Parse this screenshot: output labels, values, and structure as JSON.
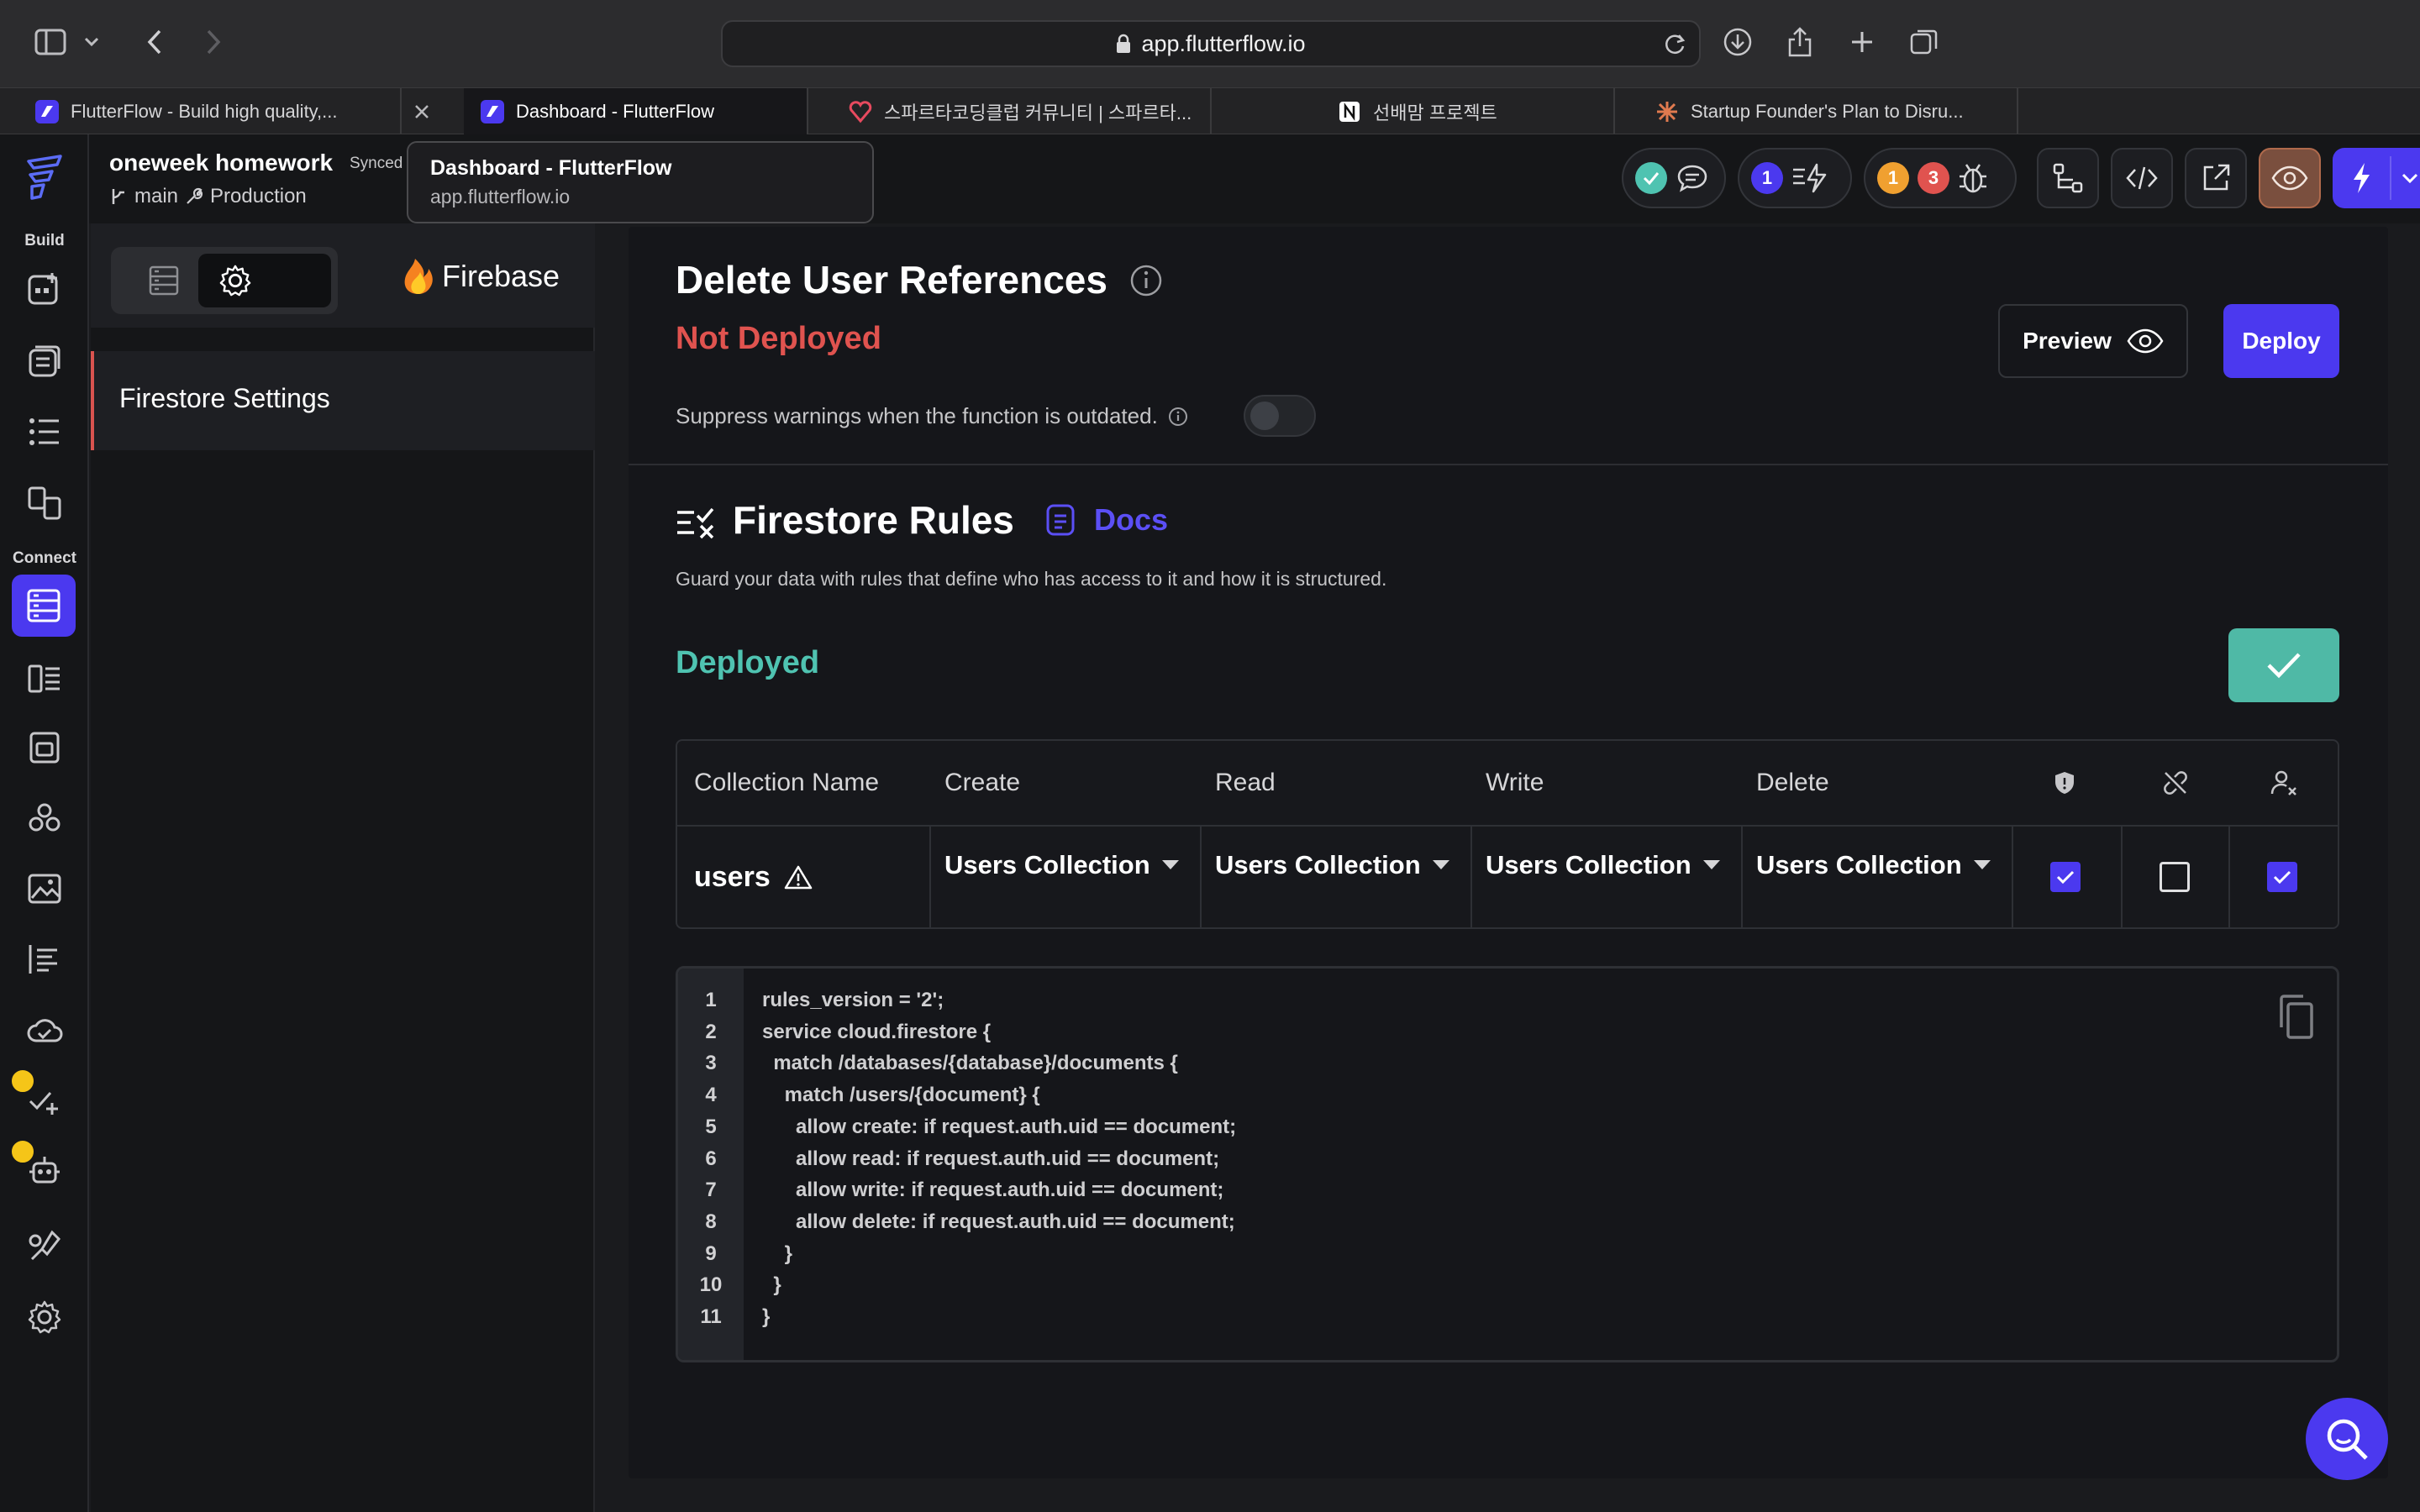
{
  "browser": {
    "url": "app.flutterflow.io",
    "tabs": [
      {
        "label": "FlutterFlow - Build high quality,..."
      },
      {
        "label": "Dashboard - FlutterFlow"
      },
      {
        "label": "스파르타코딩클럽 커뮤니티 | 스파르타..."
      },
      {
        "label": "선배맘 프로젝트"
      },
      {
        "label": "Startup Founder's Plan to Disru..."
      }
    ],
    "tooltip": {
      "title": "Dashboard - FlutterFlow",
      "url": "app.flutterflow.io"
    }
  },
  "project": {
    "name": "oneweek homework",
    "sync": "Synced",
    "branch": "main",
    "env": "Production"
  },
  "rail": {
    "build_label": "Build",
    "connect_label": "Connect"
  },
  "toolbar": {
    "badge_blue": "1",
    "badge_orange": "1",
    "badge_red": "3"
  },
  "panel": {
    "brand": "Firebase",
    "selected_item": "Firestore Settings"
  },
  "cloud_function": {
    "title": "Delete User References",
    "status": "Not Deployed",
    "suppress_text": "Suppress warnings when the function is outdated.",
    "preview_label": "Preview",
    "deploy_label": "Deploy"
  },
  "firestore_rules": {
    "title": "Firestore Rules",
    "docs_label": "Docs",
    "description": "Guard your data with rules that define who has access to it and how it is structured.",
    "status": "Deployed",
    "table": {
      "headers": [
        "Collection Name",
        "Create",
        "Read",
        "Write",
        "Delete"
      ],
      "row": {
        "collection": "users",
        "create": "Users Collection",
        "read": "Users Collection",
        "write": "Users Collection",
        "delete": "Users Collection",
        "checks": [
          true,
          false,
          true
        ]
      }
    },
    "code_lines": [
      "rules_version = '2';",
      "service cloud.firestore {",
      "  match /databases/{database}/documents {",
      "    match /users/{document} {",
      "      allow create: if request.auth.uid == document;",
      "      allow read: if request.auth.uid == document;",
      "      allow write: if request.auth.uid == document;",
      "      allow delete: if request.auth.uid == document;",
      "    }",
      "  }",
      "}"
    ]
  },
  "colors": {
    "accent": "#4b39ef",
    "error": "#e0534f",
    "success": "#4fc3b1"
  }
}
